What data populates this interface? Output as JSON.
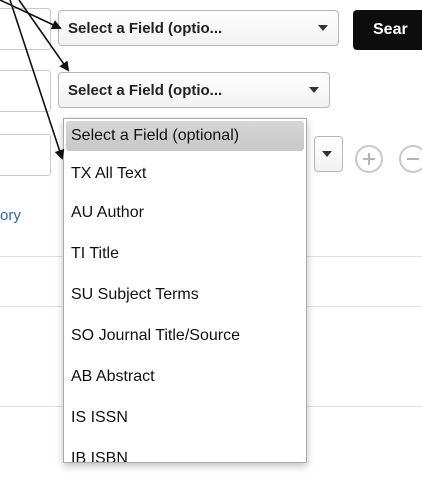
{
  "search_rows": [
    {
      "field_label": "Select a Field (optio..."
    },
    {
      "field_label": "Select a Field (optio..."
    }
  ],
  "search_button": {
    "label": "Sear"
  },
  "history_link": {
    "label": "ory"
  },
  "dropdown": {
    "options": [
      "Select a Field (optional)",
      "TX All Text",
      "AU Author",
      "TI Title",
      "SU Subject Terms",
      "SO Journal Title/Source",
      "AB Abstract",
      "IS ISSN",
      "IB ISBN"
    ],
    "highlighted_index": 0
  },
  "colors": {
    "accent_link": "#2468b2",
    "search_button_bg": "#0d0d0d",
    "highlight_bg": "#cfcfcf",
    "annotation_arrow": "#111111"
  },
  "icons": {
    "row3_buttons": [
      "plus-circle-icon",
      "minus-circle-icon"
    ],
    "select_arrow": "caret-down-icon"
  }
}
